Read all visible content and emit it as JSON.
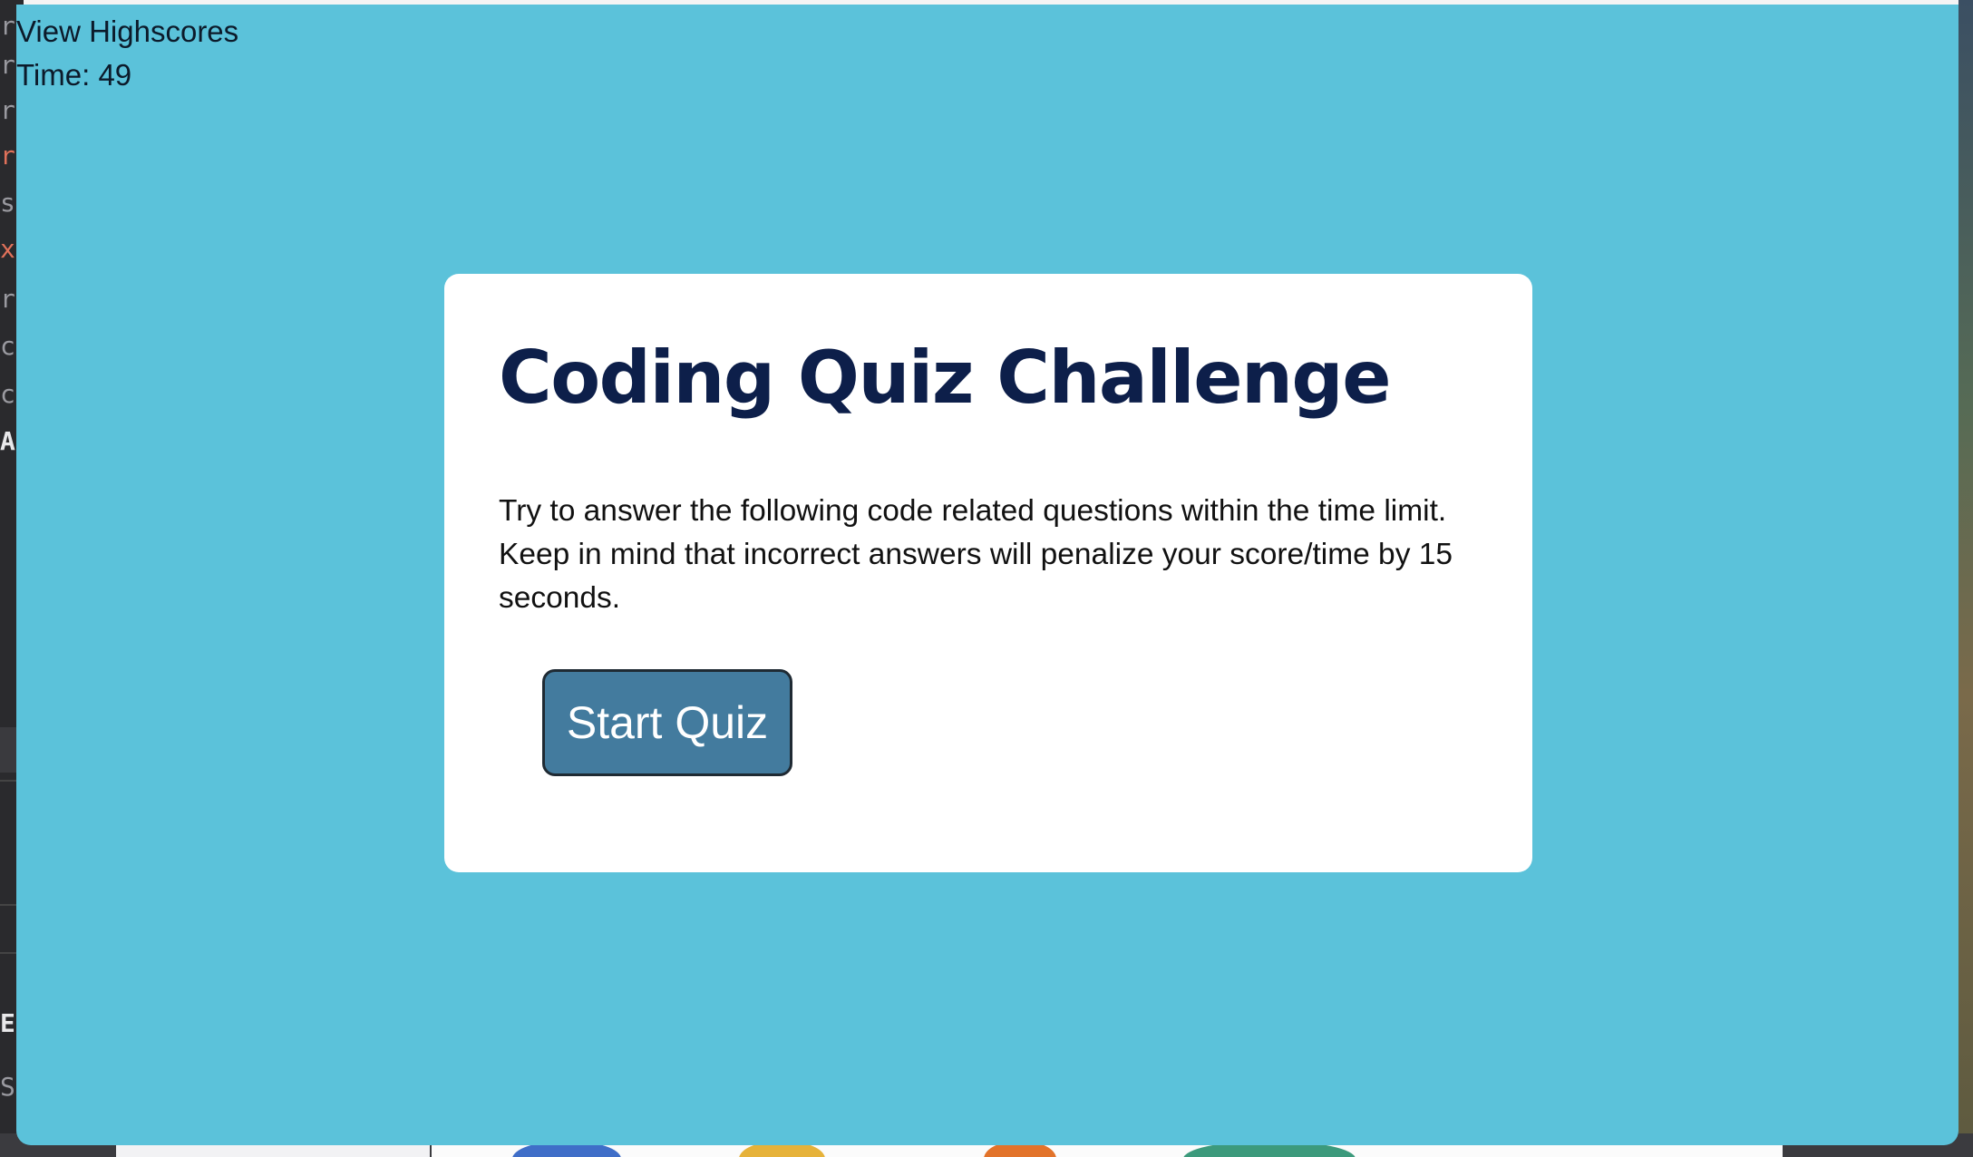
{
  "header": {
    "highscores_link": "View Highscores",
    "timer_label": "Time:",
    "timer_value": "49"
  },
  "intro": {
    "title": "Coding Quiz Challenge",
    "description": "Try to answer the following code related questions within the time limit. Keep in mind that incorrect answers will penalize your score/time by 15 seconds.",
    "start_button": "Start Quiz"
  },
  "colors": {
    "page_background": "#5bc2da",
    "card_background": "#ffffff",
    "title_color": "#0d1f4a",
    "button_background": "#437b9e",
    "button_text": "#ffffff"
  }
}
